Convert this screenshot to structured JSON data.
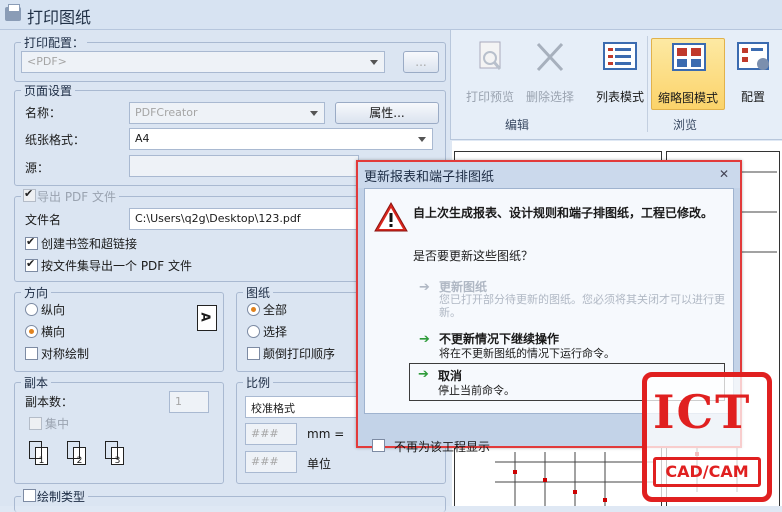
{
  "window": {
    "title": "打印图纸"
  },
  "print_config": {
    "legend": "打印配置：",
    "value": "<PDF>",
    "browse_label": "..."
  },
  "page_setup": {
    "legend": "页面设置",
    "name_label": "名称：",
    "printer_value": "PDFCreator",
    "properties_label": "属性...",
    "paper_label": "纸张格式：",
    "paper_value": "A4",
    "source_label": "源："
  },
  "pdf_export": {
    "legend": "导出 PDF 文件",
    "filename_label": "文件名",
    "filename_value": "C:\\Users\\q2g\\Desktop\\123.pdf",
    "bookmarks_label": "创建书签和超链接",
    "per_fileset_label": "按文件集导出一个 PDF 文件"
  },
  "orientation": {
    "legend": "方向",
    "portrait_label": "纵向",
    "landscape_label": "横向",
    "symmetric_label": "对称绘制",
    "icon_letter": "A"
  },
  "drawings": {
    "legend": "图纸",
    "all_label": "全部",
    "select_label": "选择",
    "reverse_label": "颠倒打印顺序"
  },
  "copies": {
    "legend": "副本",
    "count_label": "副本数：",
    "count_value": "1",
    "collate_label": "集中",
    "collate_pages": [
      "1",
      "2",
      "3"
    ]
  },
  "scale": {
    "legend": "比例",
    "value": "校准格式",
    "field1_placeholder": "###",
    "unit_mm": "mm =",
    "field2_placeholder": "###",
    "unit_label": "单位"
  },
  "draw_type": {
    "legend": "绘制类型"
  },
  "ribbon": {
    "buttons": [
      {
        "label": "打印预览",
        "icon": "print-preview-icon",
        "enabled": false
      },
      {
        "label": "删除选择",
        "icon": "delete-selection-icon",
        "enabled": false
      },
      {
        "label": "列表模式",
        "icon": "list-mode-icon",
        "enabled": true
      },
      {
        "label": "缩略图模式",
        "icon": "thumbnail-mode-icon",
        "enabled": true,
        "active": true
      },
      {
        "label": "配置",
        "icon": "config-icon",
        "enabled": true
      }
    ],
    "groups": {
      "edit": "编辑",
      "browse": "浏览"
    }
  },
  "dialog": {
    "title": "更新报表和端子排图纸",
    "close": "✕",
    "message": "自上次生成报表、设计规则和端子排图纸，工程已修改。",
    "question": "是否要更新这些图纸？",
    "options": [
      {
        "title": "更新图纸",
        "desc": "您已打开部分待更新的图纸。您必须将其关闭才可以进行更新。",
        "enabled": false
      },
      {
        "title": "不更新情况下继续操作",
        "desc": "将在不更新图纸的情况下运行命令。",
        "enabled": true
      },
      {
        "title": "取消",
        "desc": "停止当前命令。",
        "enabled": true
      }
    ],
    "dont_show_label": "不再为该工程显示"
  },
  "watermark": {
    "big": "ICT",
    "small": "CAD/CAM"
  },
  "colors": {
    "accent": "#fbd36a",
    "dialog_border": "#e23a3a",
    "watermark": "#e02020"
  }
}
